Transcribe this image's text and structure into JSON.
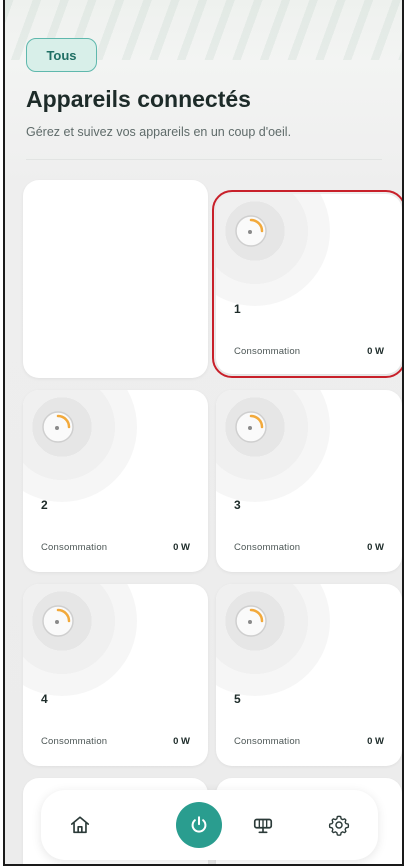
{
  "filter": {
    "chip_label": "Tous"
  },
  "header": {
    "title": "Appareils connectés",
    "subtitle": "Gérez et suivez vos appareils en un coup d'oeil."
  },
  "devices": [
    {
      "name": "1",
      "consumption_label": "Consommation",
      "consumption_value": "0 W"
    },
    {
      "name": "2",
      "consumption_label": "Consommation",
      "consumption_value": "0 W"
    },
    {
      "name": "3",
      "consumption_label": "Consommation",
      "consumption_value": "0 W"
    },
    {
      "name": "4",
      "consumption_label": "Consommation",
      "consumption_value": "0 W"
    },
    {
      "name": "5",
      "consumption_label": "Consommation",
      "consumption_value": "0 W"
    }
  ],
  "bottom_nav": {
    "items": [
      {
        "icon": "home-icon"
      },
      {
        "icon": "power-icon",
        "active": true
      },
      {
        "icon": "energy-meter-icon"
      },
      {
        "icon": "gear-icon"
      }
    ]
  },
  "colors": {
    "accent": "#2a9d8f",
    "chip_bg": "#d8efe9",
    "selection_outline": "#c8202a"
  }
}
